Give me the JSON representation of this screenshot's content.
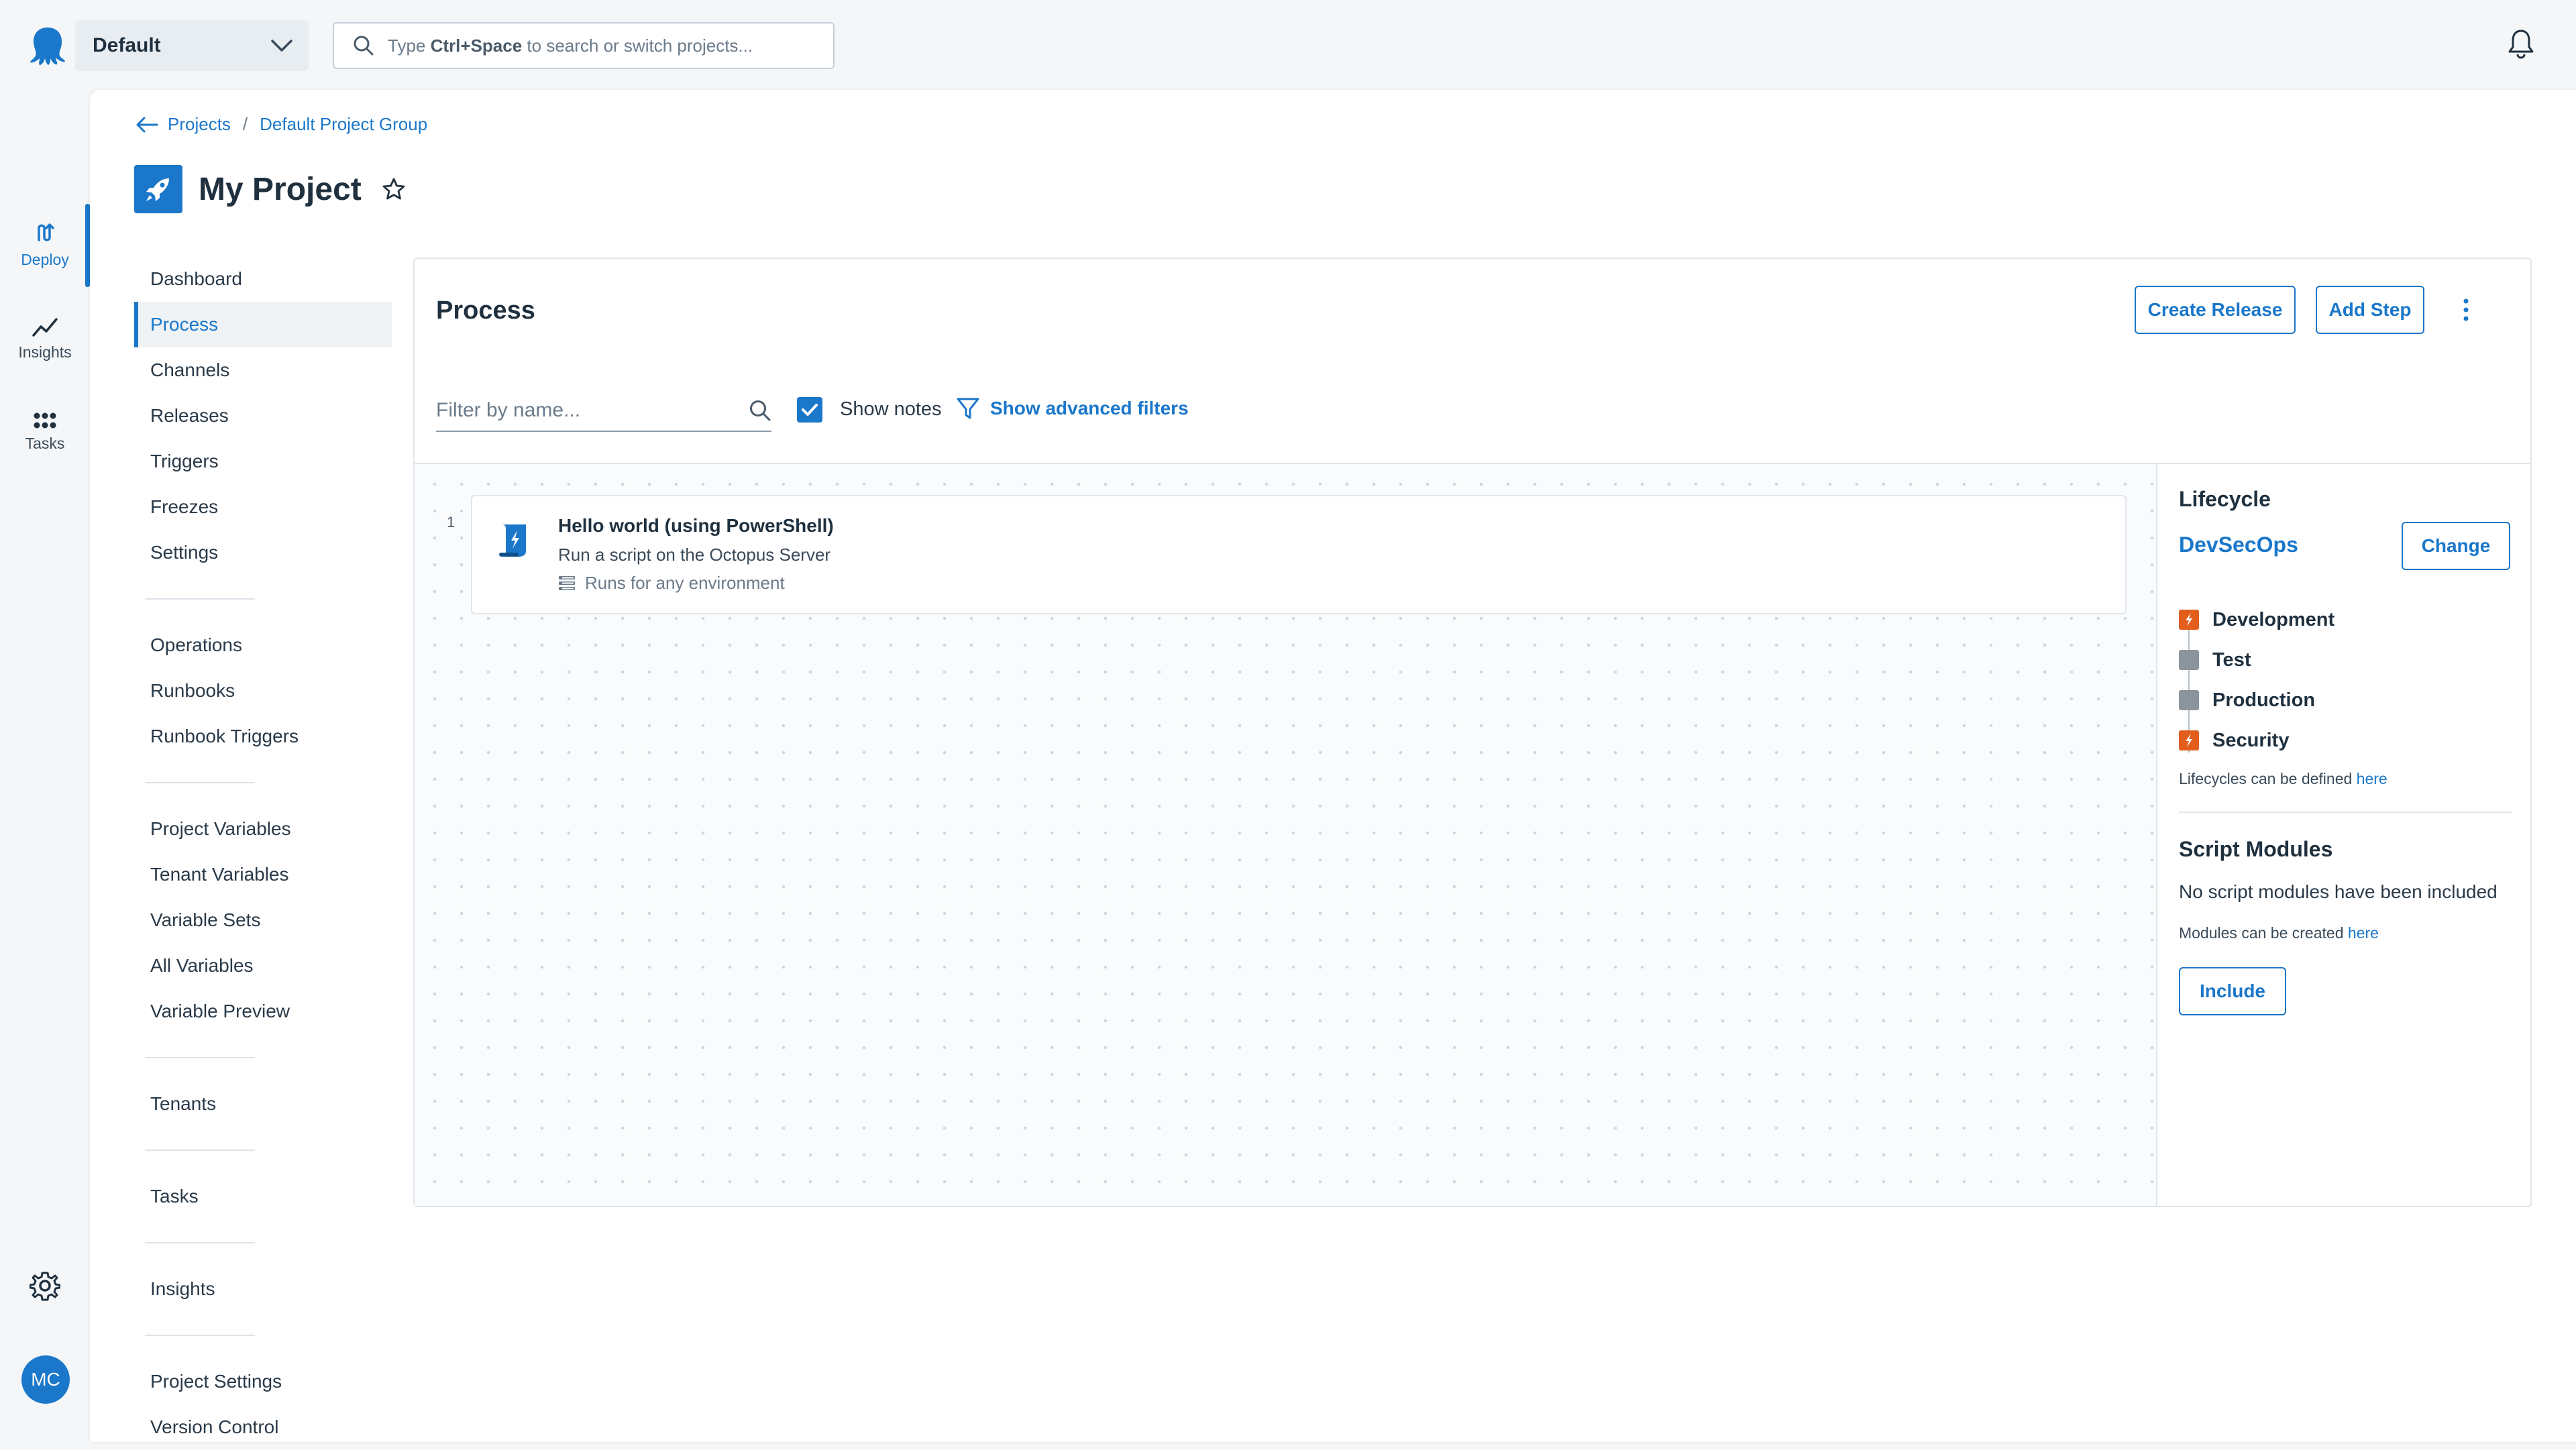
{
  "topbar": {
    "space_name": "Default",
    "search_placeholder_prefix": "Type",
    "search_placeholder_shortcut": "Ctrl+Space",
    "search_placeholder_suffix": "to search or switch projects..."
  },
  "rail": {
    "items": [
      {
        "label": "Deploy",
        "icon": "deploy-icon",
        "active": true
      },
      {
        "label": "Insights",
        "icon": "chart-line-icon",
        "active": false
      },
      {
        "label": "Tasks",
        "icon": "grid-dots-icon",
        "active": false
      }
    ],
    "avatar_initials": "MC"
  },
  "breadcrumb": {
    "items": [
      "Projects",
      "Default Project Group"
    ],
    "separator": "/"
  },
  "project": {
    "title": "My Project"
  },
  "subnav": {
    "groups": [
      [
        "Dashboard",
        "Process",
        "Channels",
        "Releases",
        "Triggers",
        "Freezes",
        "Settings"
      ],
      [
        "Operations",
        "Runbooks",
        "Runbook Triggers"
      ],
      [
        "Project Variables",
        "Tenant Variables",
        "Variable Sets",
        "All Variables",
        "Variable Preview"
      ],
      [
        "Tenants"
      ],
      [
        "Tasks"
      ],
      [
        "Insights"
      ],
      [
        "Project Settings",
        "Version Control"
      ]
    ],
    "active": "Process"
  },
  "process": {
    "title": "Process",
    "create_release_label": "Create Release",
    "add_step_label": "Add Step",
    "filter_placeholder": "Filter by name...",
    "show_notes_label": "Show notes",
    "show_notes_checked": true,
    "advanced_filters_label": "Show advanced filters",
    "steps": [
      {
        "number": "1",
        "title": "Hello world (using PowerShell)",
        "subtitle": "Run a script on the Octopus Server",
        "environment_note": "Runs for any environment"
      }
    ]
  },
  "lifecycle": {
    "heading": "Lifecycle",
    "name": "DevSecOps",
    "change_label": "Change",
    "phases": [
      {
        "name": "Development",
        "status": "done"
      },
      {
        "name": "Test",
        "status": "pending"
      },
      {
        "name": "Production",
        "status": "pending"
      },
      {
        "name": "Security",
        "status": "done"
      }
    ],
    "note_prefix": "Lifecycles can be defined",
    "note_link": "here"
  },
  "script_modules": {
    "heading": "Script Modules",
    "empty_text": "No script modules have been included",
    "note_prefix": "Modules can be created",
    "note_link": "here",
    "include_label": "Include"
  },
  "colors": {
    "accent": "#1a77ca",
    "phase_done": "#e35d1c",
    "phase_pending": "#8b949c",
    "background": "#f4f6f8"
  }
}
